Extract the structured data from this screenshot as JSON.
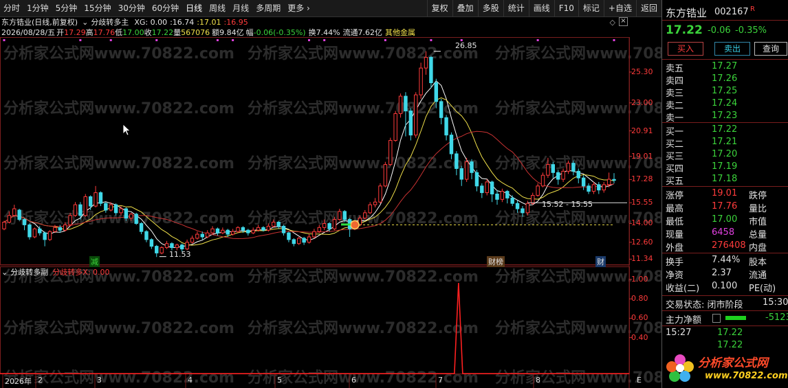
{
  "toolbar": {
    "tabs": [
      "分时",
      "1分钟",
      "5分钟",
      "15分钟",
      "30分钟",
      "60分钟",
      "日线",
      "周线",
      "月线",
      "多周期",
      "更多"
    ],
    "more_arrow": "›",
    "right_tabs": [
      "复权",
      "叠加",
      "多股",
      "统计",
      "画线",
      "F10",
      "标记",
      "+自选",
      "返回"
    ]
  },
  "info": {
    "stock_title": "东方锆业(日线,前复权)",
    "indicator_name": "分歧转多主",
    "xg_label": "XG: 0.00",
    "ind_v1": "16.74",
    "ind_v2": "17.01",
    "ind_v3": "16.95",
    "date": "2026/08/28/五",
    "open_label": "开",
    "open": "17.29",
    "high_label": "高",
    "high": "17.76",
    "low_label": "低",
    "low": "17.00",
    "close_label": "收",
    "close": "17.22",
    "vol_label": "量",
    "vol": "567076",
    "amount": "额9.84亿",
    "change_label": "幅",
    "change": "-0.06(-0.35%)",
    "turnover": "换7.44%",
    "float_cap": "流通7.62亿",
    "sector": "其他金属"
  },
  "price_axis": [
    "25.30",
    "23.00",
    "20.91",
    "19.01",
    "17.28",
    "15.55",
    "14.00",
    "12.60",
    "11.34"
  ],
  "sub_axis": [
    "1.00",
    "0.80",
    "0.60",
    "0.40"
  ],
  "x_axis": [
    "2026年",
    "2",
    "3",
    "4",
    "5",
    "6",
    "7",
    "8"
  ],
  "annotations": {
    "high_label": "26.85",
    "low_label": "11.53",
    "range_label": "15.52 - 15.55",
    "tag_jian": "减",
    "tag_caibang": "财榜",
    "tag_cai": "财"
  },
  "sub": {
    "name": "分歧转多副",
    "value_label": "分歧转多X: 0.00"
  },
  "corner_e": "E",
  "watermark": "分析家公式网www.70822.com",
  "panel": {
    "name": "东方锆业",
    "code": "002167",
    "flag": "R",
    "price": "17.22",
    "chg": "-0.06",
    "pct": "-0.35%",
    "buy_btn": "买入",
    "sell_btn": "卖出",
    "query_btn": "查询",
    "asks": [
      {
        "label": "卖五",
        "price": "17.27"
      },
      {
        "label": "卖四",
        "price": "17.26"
      },
      {
        "label": "卖三",
        "price": "17.25"
      },
      {
        "label": "卖二",
        "price": "17.24"
      },
      {
        "label": "卖一",
        "price": "17.23"
      }
    ],
    "bids": [
      {
        "label": "买一",
        "price": "17.22"
      },
      {
        "label": "买二",
        "price": "17.21"
      },
      {
        "label": "买三",
        "price": "17.20"
      },
      {
        "label": "买四",
        "price": "17.19"
      },
      {
        "label": "买五",
        "price": "17.18"
      }
    ],
    "stats": [
      {
        "k": "涨停",
        "v": "19.01",
        "k2": "跌停",
        "color": "#ff3b3b"
      },
      {
        "k": "最高",
        "v": "17.76",
        "k2": "量比",
        "color": "#ff3b3b"
      },
      {
        "k": "最低",
        "v": "17.00",
        "k2": "市值",
        "color": "#3bd33b"
      },
      {
        "k": "现量",
        "v": "6458",
        "k2": "总量",
        "color": "#e040e0"
      },
      {
        "k": "外盘",
        "v": "276408",
        "k2": "内盘",
        "color": "#ff3b3b"
      }
    ],
    "stats2": [
      {
        "k": "换手",
        "v": "7.44%",
        "k2": "股本"
      },
      {
        "k": "净资",
        "v": "2.37",
        "k2": "流通"
      },
      {
        "k": "收益(二)",
        "v": "0.100",
        "k2": "PE(动)"
      }
    ],
    "status_label": "交易状态: 闭市阶段",
    "status_time": "15:30",
    "mainforce_label": "主力净额",
    "mainforce_value": "-5123",
    "ticks": [
      {
        "time": "15:27",
        "price": "17.22"
      },
      {
        "time": "",
        "price": "17.22"
      }
    ],
    "logo_text": "分析家公式网",
    "logo_url": "www.70822.com"
  },
  "colors": {
    "up": "#ff3b3b",
    "down": "#40d8e8",
    "ma5": "#ffffff",
    "ma10": "#f0e04a",
    "ma20": "#c83232",
    "axis": "#7a1d1d"
  },
  "chart_data": {
    "type": "candlestick",
    "ylim": [
      11.0,
      27.5
    ],
    "candles": [
      [
        13.6,
        14.1,
        13.5,
        14.2
      ],
      [
        14.1,
        14.6,
        14.0,
        14.9
      ],
      [
        14.6,
        15.1,
        14.5,
        15.4
      ],
      [
        15.0,
        14.3,
        14.2,
        15.1
      ],
      [
        14.3,
        13.9,
        13.5,
        14.4
      ],
      [
        13.9,
        13.0,
        12.8,
        14.0
      ],
      [
        13.0,
        13.6,
        12.9,
        13.7
      ],
      [
        13.6,
        13.3,
        13.1,
        13.8
      ],
      [
        13.3,
        12.8,
        12.3,
        13.4
      ],
      [
        12.8,
        13.4,
        12.7,
        13.5
      ],
      [
        13.4,
        13.7,
        13.3,
        13.9
      ],
      [
        13.7,
        13.5,
        13.3,
        13.9
      ],
      [
        13.5,
        13.9,
        13.4,
        14.1
      ],
      [
        13.9,
        14.6,
        13.8,
        14.8
      ],
      [
        14.6,
        15.4,
        14.5,
        15.6
      ],
      [
        15.4,
        14.6,
        14.3,
        15.6
      ],
      [
        14.6,
        16.0,
        14.5,
        16.2
      ],
      [
        16.0,
        15.3,
        15.0,
        16.1
      ],
      [
        15.3,
        16.3,
        15.2,
        16.8
      ],
      [
        16.3,
        15.5,
        15.3,
        16.4
      ],
      [
        15.5,
        15.0,
        14.8,
        15.6
      ],
      [
        15.0,
        15.4,
        14.9,
        15.6
      ],
      [
        15.4,
        14.8,
        14.6,
        15.5
      ],
      [
        14.8,
        15.1,
        14.6,
        15.3
      ],
      [
        15.1,
        14.4,
        14.2,
        15.2
      ],
      [
        14.4,
        14.7,
        14.2,
        14.8
      ],
      [
        14.7,
        14.0,
        13.9,
        14.8
      ],
      [
        14.0,
        13.4,
        13.2,
        14.1
      ],
      [
        13.4,
        12.8,
        12.6,
        13.5
      ],
      [
        12.8,
        12.3,
        12.1,
        12.9
      ],
      [
        12.3,
        11.8,
        11.5,
        12.4
      ],
      [
        11.8,
        12.2,
        11.7,
        12.3
      ],
      [
        12.2,
        12.5,
        12.1,
        12.7
      ],
      [
        12.5,
        12.2,
        12.0,
        12.6
      ],
      [
        12.2,
        12.4,
        12.0,
        12.5
      ],
      [
        12.4,
        12.1,
        11.9,
        12.5
      ],
      [
        12.1,
        12.6,
        12.0,
        12.8
      ],
      [
        12.6,
        12.9,
        12.5,
        13.1
      ],
      [
        12.9,
        13.2,
        12.8,
        13.4
      ],
      [
        13.2,
        13.0,
        12.8,
        13.4
      ],
      [
        13.0,
        13.3,
        12.9,
        13.5
      ],
      [
        13.3,
        13.6,
        13.2,
        13.8
      ],
      [
        13.6,
        13.3,
        13.1,
        13.7
      ],
      [
        13.3,
        13.5,
        13.2,
        13.7
      ],
      [
        13.5,
        13.2,
        13.0,
        13.6
      ],
      [
        13.2,
        13.4,
        13.1,
        13.6
      ],
      [
        13.4,
        13.7,
        13.3,
        13.8
      ],
      [
        13.7,
        13.5,
        13.3,
        13.8
      ],
      [
        13.5,
        13.3,
        13.1,
        13.6
      ],
      [
        13.3,
        13.5,
        13.2,
        13.7
      ],
      [
        13.5,
        13.7,
        13.4,
        13.9
      ],
      [
        13.7,
        13.5,
        13.4,
        13.8
      ],
      [
        13.5,
        13.8,
        13.4,
        14.0
      ],
      [
        13.8,
        14.1,
        13.7,
        14.3
      ],
      [
        14.1,
        13.8,
        13.6,
        14.2
      ],
      [
        13.8,
        13.3,
        13.1,
        13.9
      ],
      [
        13.3,
        12.8,
        12.6,
        13.4
      ],
      [
        12.8,
        12.5,
        12.3,
        12.9
      ],
      [
        12.5,
        12.9,
        12.4,
        13.0
      ],
      [
        12.9,
        12.6,
        12.4,
        13.0
      ],
      [
        12.6,
        13.0,
        12.5,
        13.2
      ],
      [
        13.0,
        13.4,
        12.9,
        13.6
      ],
      [
        13.4,
        13.7,
        13.3,
        13.9
      ],
      [
        13.7,
        14.0,
        13.5,
        14.3
      ],
      [
        14.0,
        13.6,
        13.4,
        14.1
      ],
      [
        13.6,
        14.3,
        13.5,
        14.5
      ],
      [
        14.3,
        14.9,
        14.2,
        15.1
      ],
      [
        14.9,
        14.3,
        14.1,
        15.0
      ],
      [
        14.3,
        13.6,
        13.0,
        14.4
      ],
      [
        13.6,
        13.9,
        13.5,
        14.1
      ],
      [
        13.9,
        14.4,
        13.8,
        14.6
      ],
      [
        14.4,
        14.8,
        14.3,
        15.0
      ],
      [
        14.8,
        15.4,
        14.7,
        15.6
      ],
      [
        15.4,
        15.6,
        15.2,
        15.9
      ],
      [
        15.6,
        16.8,
        15.5,
        17.0
      ],
      [
        16.8,
        18.4,
        16.7,
        18.6
      ],
      [
        18.4,
        20.2,
        18.3,
        20.4
      ],
      [
        20.2,
        22.2,
        20.1,
        22.4
      ],
      [
        22.2,
        23.5,
        21.9,
        23.7
      ],
      [
        23.5,
        22.4,
        20.5,
        23.8
      ],
      [
        22.4,
        20.6,
        20.2,
        22.6
      ],
      [
        20.6,
        23.6,
        20.4,
        23.8
      ],
      [
        23.6,
        25.6,
        23.3,
        26.0
      ],
      [
        25.6,
        26.4,
        25.1,
        26.85
      ],
      [
        26.4,
        24.5,
        24.1,
        26.5
      ],
      [
        24.5,
        23.1,
        22.6,
        24.8
      ],
      [
        23.1,
        21.9,
        21.4,
        23.3
      ],
      [
        21.9,
        20.6,
        20.2,
        22.1
      ],
      [
        20.6,
        19.2,
        18.8,
        20.8
      ],
      [
        19.2,
        18.1,
        17.6,
        19.4
      ],
      [
        18.1,
        17.3,
        16.8,
        18.3
      ],
      [
        17.3,
        18.6,
        17.1,
        18.9
      ],
      [
        18.6,
        17.8,
        17.3,
        18.8
      ],
      [
        17.8,
        16.8,
        16.4,
        18.0
      ],
      [
        16.8,
        16.3,
        15.9,
        17.0
      ],
      [
        16.3,
        17.1,
        16.1,
        17.3
      ],
      [
        17.1,
        16.2,
        15.6,
        17.2
      ],
      [
        16.2,
        15.8,
        15.4,
        16.5
      ],
      [
        15.8,
        16.4,
        15.6,
        16.6
      ],
      [
        16.4,
        15.9,
        15.5,
        16.5
      ],
      [
        15.9,
        15.5,
        15.3,
        16.1
      ],
      [
        15.5,
        15.1,
        14.8,
        15.7
      ],
      [
        15.1,
        14.8,
        14.5,
        15.3
      ],
      [
        14.8,
        15.5,
        14.6,
        15.7
      ],
      [
        15.5,
        16.1,
        15.4,
        16.3
      ],
      [
        16.1,
        16.8,
        16.0,
        17.0
      ],
      [
        16.8,
        17.6,
        16.7,
        17.8
      ],
      [
        17.6,
        18.4,
        17.4,
        18.9
      ],
      [
        18.4,
        17.8,
        17.4,
        18.6
      ],
      [
        17.8,
        17.3,
        16.9,
        18.0
      ],
      [
        17.3,
        17.9,
        17.1,
        18.1
      ],
      [
        17.9,
        18.5,
        17.7,
        18.7
      ],
      [
        18.5,
        17.9,
        17.6,
        18.7
      ],
      [
        17.9,
        17.4,
        17.0,
        18.1
      ],
      [
        17.4,
        16.8,
        16.5,
        17.6
      ],
      [
        16.8,
        16.4,
        16.2,
        17.0
      ],
      [
        16.4,
        16.9,
        16.2,
        17.1
      ],
      [
        16.9,
        16.5,
        16.2,
        17.1
      ],
      [
        16.5,
        16.9,
        16.3,
        17.1
      ],
      [
        16.9,
        17.3,
        16.7,
        17.8
      ],
      [
        17.29,
        17.22,
        17.0,
        17.76
      ]
    ],
    "signal_index": 69
  }
}
